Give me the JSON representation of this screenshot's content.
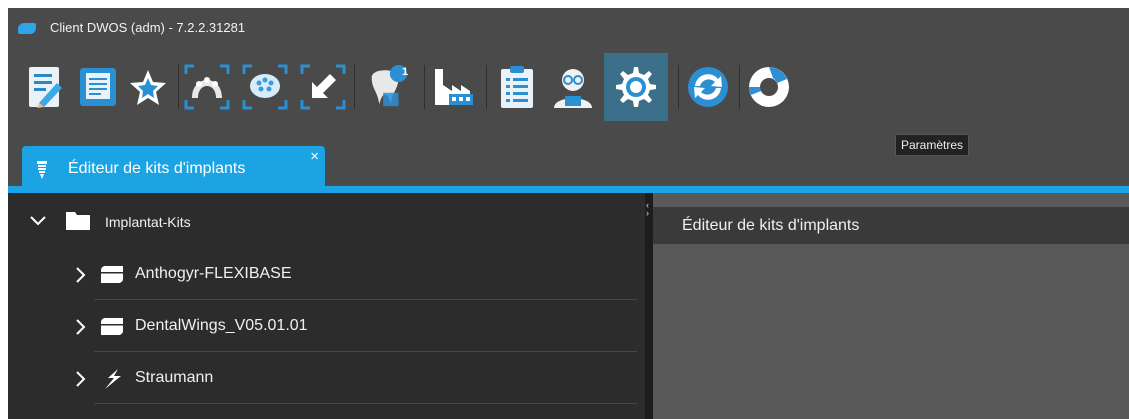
{
  "window": {
    "title": "Client DWOS (adm) - 7.2.2.31281"
  },
  "toolbar": {
    "buttons": [
      {
        "icon": "edit-document-icon"
      },
      {
        "icon": "document-list-icon"
      },
      {
        "icon": "star-icon"
      },
      {
        "icon": "scan-upper-jaw-icon"
      },
      {
        "icon": "scan-impression-icon"
      },
      {
        "icon": "import-arrow-icon"
      },
      {
        "icon": "tooth-notification-icon",
        "badge": "1"
      },
      {
        "icon": "factory-icon"
      },
      {
        "icon": "clipboard-checklist-icon"
      },
      {
        "icon": "user-glasses-icon"
      },
      {
        "icon": "gear-icon",
        "active": true
      },
      {
        "icon": "refresh-icon"
      },
      {
        "icon": "lifebuoy-help-icon"
      }
    ],
    "tooltip": "Paramètres"
  },
  "tab": {
    "label": "Éditeur de kits d'implants",
    "close": "×"
  },
  "tree": {
    "root": {
      "label": "Implantat-Kits"
    },
    "items": [
      {
        "label": "Anthogyr-FLEXIBASE",
        "icon": "kit-icon"
      },
      {
        "label": "DentalWings_V05.01.01",
        "icon": "kit-icon"
      },
      {
        "label": "Straumann",
        "icon": "straumann-logo-icon"
      }
    ]
  },
  "panel": {
    "title": "Éditeur de kits d'implants"
  },
  "colors": {
    "accent": "#1ba3e4",
    "active_button": "#3c6f8a"
  }
}
